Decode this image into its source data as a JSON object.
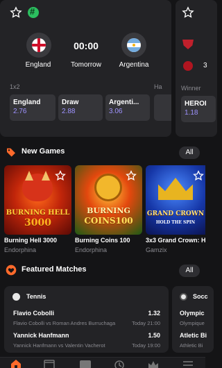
{
  "match": {
    "home_team": "England",
    "away_team": "Argentina",
    "score": "00:00",
    "time_label": "Tomorrow",
    "market_label": "1x2",
    "market_peek": "Ha",
    "odds": [
      {
        "label": "England",
        "value": "2.76"
      },
      {
        "label": "Draw",
        "value": "2.88"
      },
      {
        "label": "Argenti...",
        "value": "3.06"
      }
    ]
  },
  "peek_match": {
    "score_peek": "3",
    "winner_label": "Winner",
    "odd_label": "HEROI",
    "odd_value": "1.18"
  },
  "new_games": {
    "title": "New Games",
    "all_label": "All",
    "items": [
      {
        "name": "Burning Hell 3000",
        "provider": "Endorphina",
        "art_line1": "BURNING HELL",
        "art_line2": "3000"
      },
      {
        "name": "Burning Coins 100",
        "provider": "Endorphina",
        "art_line1": "BURNING",
        "art_line2": "COINS100"
      },
      {
        "name": "3x3 Grand Crown: H...",
        "provider": "Gamzix",
        "art_line1": "GRAND CROWN",
        "art_line2": "HOLD THE SPIN"
      }
    ]
  },
  "featured": {
    "title": "Featured Matches",
    "all_label": "All",
    "card1": {
      "sport": "Tennis",
      "rows": [
        {
          "player": "Flavio Cobolli",
          "sub": "Flavio Cobolli vs Roman Andres Burruchaga",
          "odds": "1.32",
          "time": "Today 21:00"
        },
        {
          "player": "Yannick Hanfmann",
          "sub": "Yannick Hanfmann vs Valentin Vacherot",
          "odds": "1.50",
          "time": "Today 19:00"
        }
      ]
    },
    "card2": {
      "sport": "Socc",
      "rows": [
        {
          "player": "Olympic",
          "sub": "Olympique"
        },
        {
          "player": "Atletic Bi",
          "sub": "Athletic Bi"
        }
      ]
    }
  },
  "colors": {
    "accent": "#ff6a2b",
    "odds": "#9f93ff",
    "card": "#232326",
    "background": "#141416"
  }
}
